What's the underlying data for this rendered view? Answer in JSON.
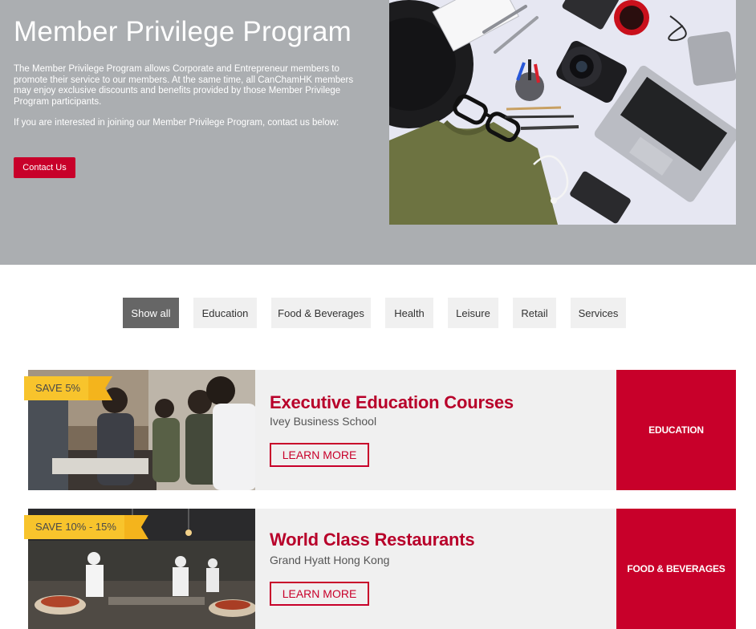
{
  "hero": {
    "title": "Member Privilege Program",
    "paragraph1": "The Member Privilege Program allows Corporate and Entrepreneur members to promote their service to our members. At the same time, all CanChamHK members may enjoy exclusive discounts and benefits provided by those Member Privilege Program participants.",
    "paragraph2": "If you are interested in joining our Member Privilege Program, contact us below:",
    "contact_label": "Contact Us"
  },
  "filters": [
    {
      "label": "Show all",
      "active": true
    },
    {
      "label": "Education",
      "active": false
    },
    {
      "label": "Food & Beverages",
      "active": false
    },
    {
      "label": "Health",
      "active": false
    },
    {
      "label": "Leisure",
      "active": false
    },
    {
      "label": "Retail",
      "active": false
    },
    {
      "label": "Services",
      "active": false
    }
  ],
  "offers": [
    {
      "badge": "SAVE 5%",
      "title": "Executive Education Courses",
      "provider": "Ivey Business School",
      "button": "LEARN MORE",
      "category": "EDUCATION"
    },
    {
      "badge": "SAVE 10% - 15%",
      "title": "World Class Restaurants",
      "provider": "Grand Hyatt Hong Kong",
      "button": "LEARN MORE",
      "category": "FOOD & BEVERAGES"
    }
  ],
  "colors": {
    "accent": "#c8002a",
    "hero_bg": "#abaeb1",
    "badge": "#f8c42c"
  }
}
